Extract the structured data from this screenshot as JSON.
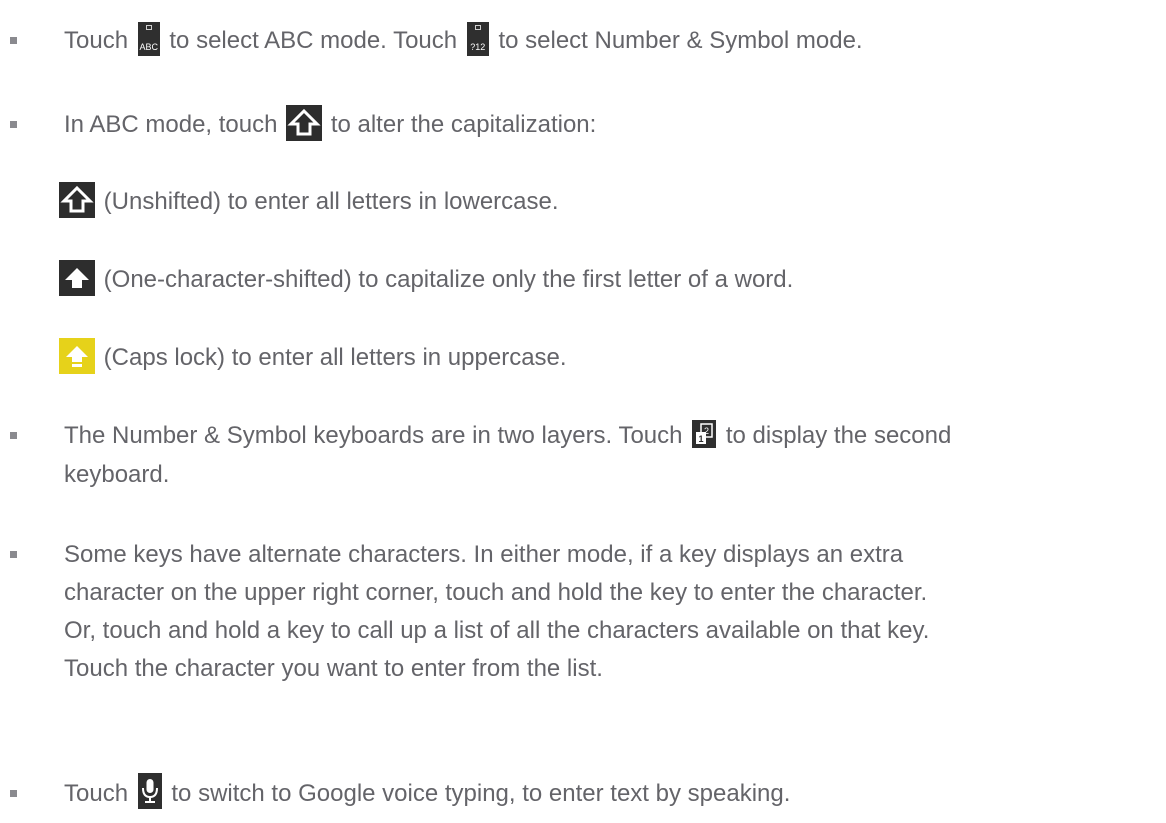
{
  "items": {
    "mode_select": {
      "part1": "Touch",
      "abc_key_label": "ABC",
      "part2": "to select ABC mode. Touch",
      "num_key_label": "?12",
      "part3": "to select Number & Symbol mode."
    },
    "capitalization": {
      "part1": "In ABC mode, touch",
      "part2": "to alter the capitalization:"
    },
    "unshifted": {
      "text": "(Unshifted) to enter all letters in lowercase."
    },
    "one_shifted": {
      "text": "(One-character-shifted) to capitalize only the first letter of a word."
    },
    "caps_lock": {
      "text": "(Caps lock) to enter all letters in uppercase."
    },
    "layers": {
      "part1": "The Number & Symbol keyboards are in two layers. Touch",
      "part2": "to display the second",
      "line2": "keyboard."
    },
    "alternate": {
      "line1": "Some keys have alternate characters. In either mode, if a key displays an extra",
      "line2": "character on the upper right corner, touch and hold the key to enter the character.",
      "line3": "Or, touch and hold a key to call up a list of all the characters available on that key.",
      "line4": "Touch the character you want to enter from the list."
    },
    "voice": {
      "part1": "Touch",
      "part2": "to switch to Google voice typing, to enter text by speaking."
    }
  },
  "icons": {
    "abc_key": "abc-key-icon",
    "num_key": "number-symbol-key-icon",
    "shift_key": "shift-unshifted-icon",
    "shift_one": "shift-one-character-icon",
    "caps_lock": "caps-lock-icon",
    "layer_key": "layer-switch-icon",
    "mic_key": "microphone-icon"
  },
  "colors": {
    "text": "#646469",
    "key_background": "#2f2f2f",
    "caps_lock_yellow": "#e6d21a"
  }
}
